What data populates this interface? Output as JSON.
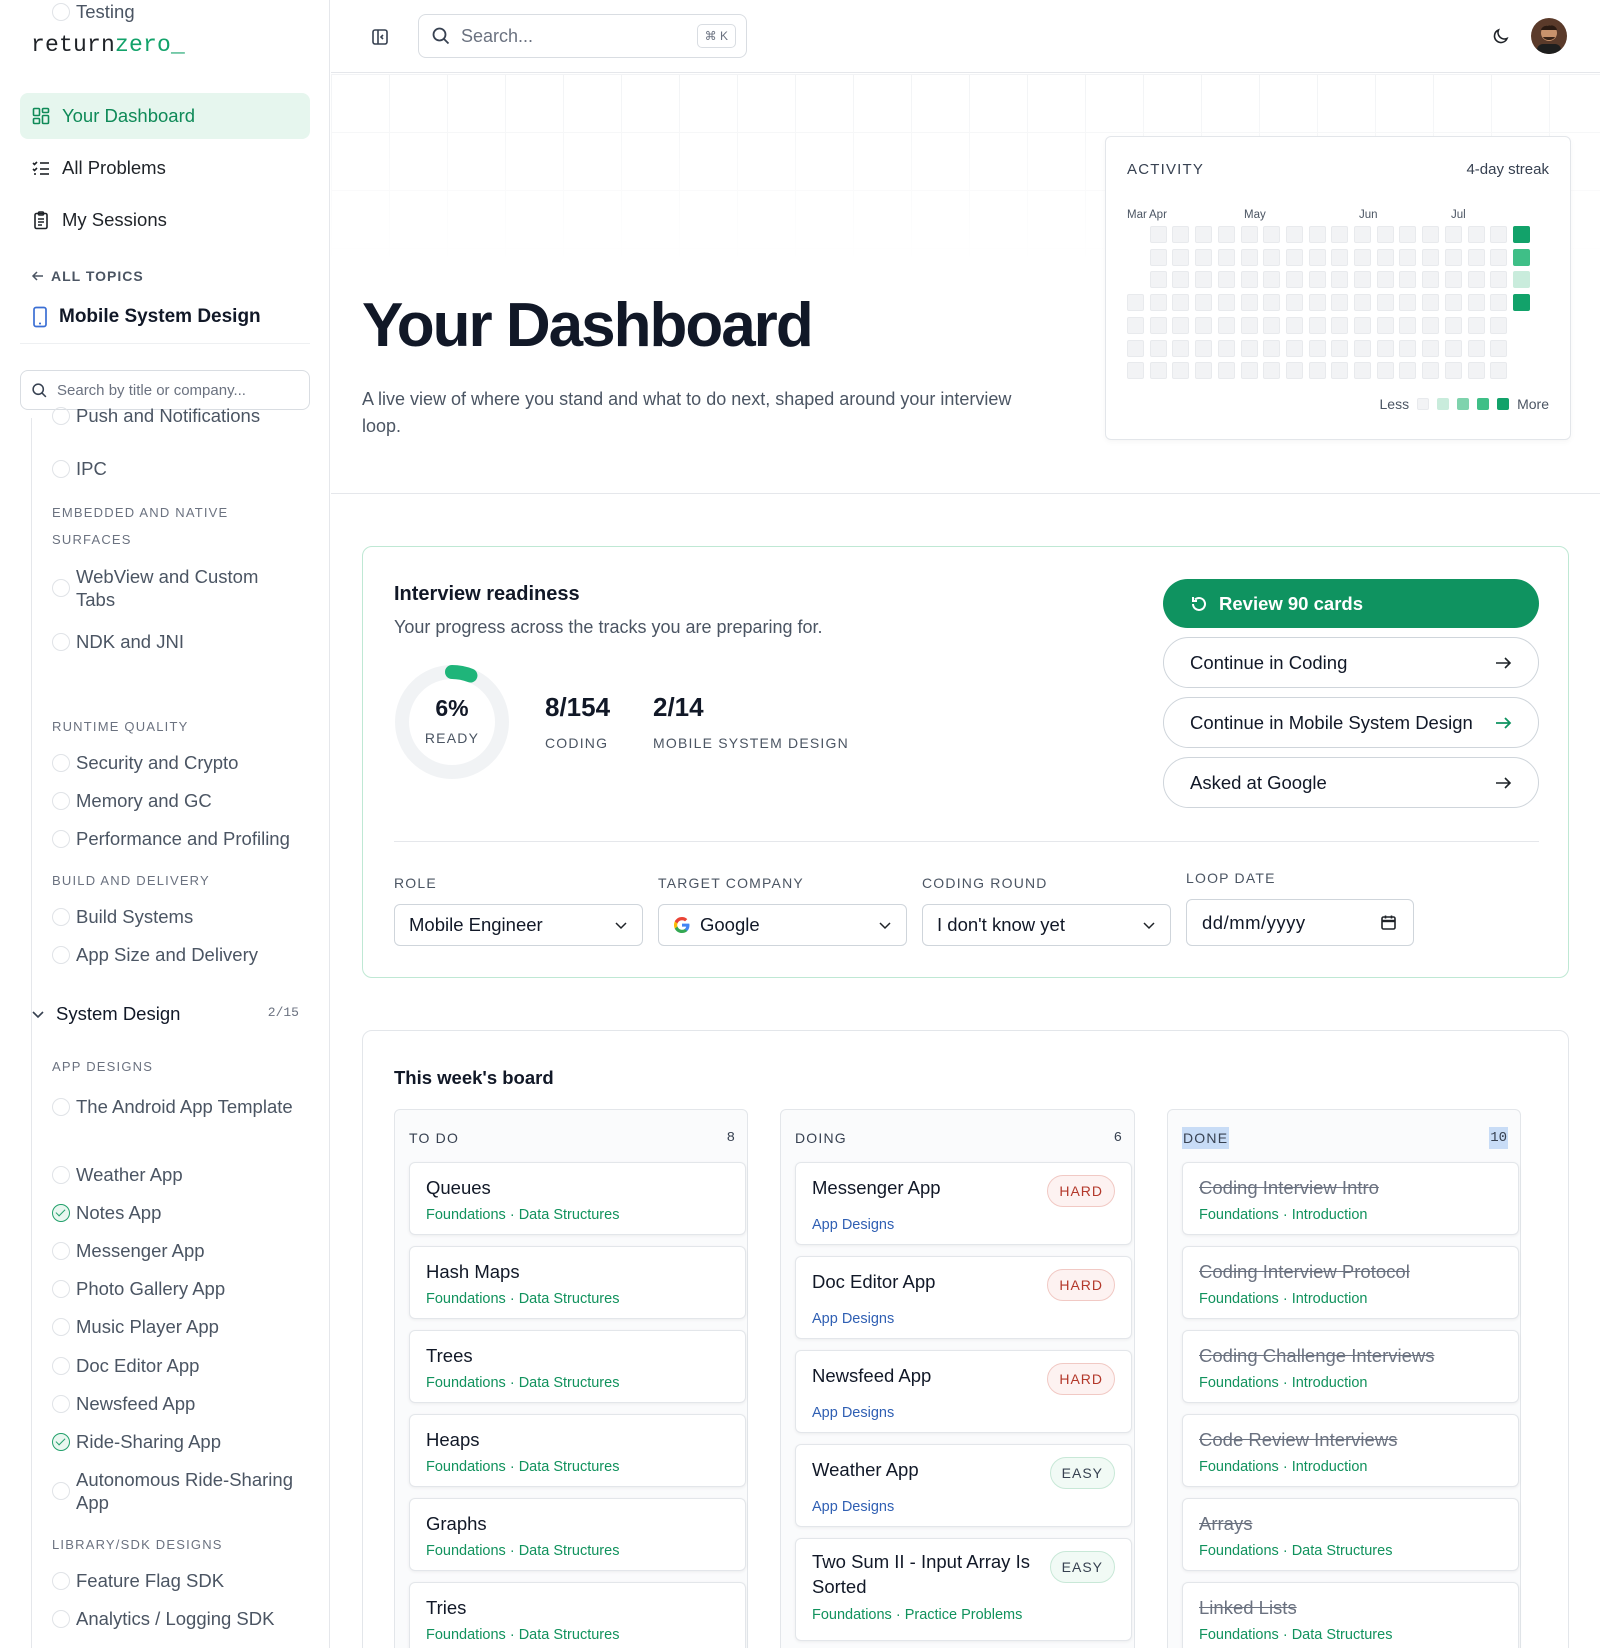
{
  "brand": {
    "logo_part1": "return",
    "logo_part2": "zero",
    "logo_part3": "_"
  },
  "sidebar": {
    "nav": [
      {
        "label": "Your Dashboard",
        "icon": "dashboard-icon",
        "active": true
      },
      {
        "label": "All Problems",
        "icon": "list-check-icon",
        "active": false
      },
      {
        "label": "My Sessions",
        "icon": "clipboard-icon",
        "active": false
      }
    ],
    "all_topics_label": "ALL TOPICS",
    "topic_title": "Mobile System Design",
    "search_placeholder": "Search by title or company...",
    "items": [
      {
        "kind": "item",
        "label": "Push and Notifications",
        "done": false
      },
      {
        "kind": "item",
        "label": "IPC",
        "done": false
      },
      {
        "kind": "head",
        "label": "EMBEDDED AND NATIVE SURFACES"
      },
      {
        "kind": "item",
        "label": "WebView and Custom Tabs",
        "done": false
      },
      {
        "kind": "item",
        "label": "NDK and JNI",
        "done": false
      },
      {
        "kind": "head",
        "label": "RUNTIME QUALITY"
      },
      {
        "kind": "item",
        "label": "Security and Crypto",
        "done": false
      },
      {
        "kind": "item",
        "label": "Memory and GC",
        "done": false
      },
      {
        "kind": "item",
        "label": "Performance and Profiling",
        "done": false
      },
      {
        "kind": "head",
        "label": "BUILD AND DELIVERY"
      },
      {
        "kind": "item",
        "label": "Build Systems",
        "done": false
      },
      {
        "kind": "item",
        "label": "App Size and Delivery",
        "done": false
      },
      {
        "kind": "item",
        "label": "Testing",
        "done": false
      }
    ],
    "system_design": {
      "label": "System Design",
      "count": "2/15"
    },
    "items2": [
      {
        "kind": "head",
        "label": "APP DESIGNS"
      },
      {
        "kind": "item",
        "label": "The Android App Template",
        "done": false
      },
      {
        "kind": "item",
        "label": "Weather App",
        "done": false
      },
      {
        "kind": "item",
        "label": "Notes App",
        "done": true
      },
      {
        "kind": "item",
        "label": "Messenger App",
        "done": false
      },
      {
        "kind": "item",
        "label": "Photo Gallery App",
        "done": false
      },
      {
        "kind": "item",
        "label": "Music Player App",
        "done": false
      },
      {
        "kind": "item",
        "label": "Doc Editor App",
        "done": false
      },
      {
        "kind": "item",
        "label": "Newsfeed App",
        "done": false
      },
      {
        "kind": "item",
        "label": "Ride-Sharing App",
        "done": true
      },
      {
        "kind": "item",
        "label": "Autonomous Ride-Sharing App",
        "done": false
      },
      {
        "kind": "head",
        "label": "LIBRARY/SDK DESIGNS"
      },
      {
        "kind": "item",
        "label": "Feature Flag SDK",
        "done": false
      },
      {
        "kind": "item",
        "label": "Analytics / Logging SDK",
        "done": false
      }
    ]
  },
  "topbar": {
    "search_placeholder": "Search...",
    "shortcut": "⌘ K",
    "theme_icon": "moon-icon",
    "avatar_icon": "avatar"
  },
  "hero": {
    "title": "Your Dashboard",
    "subtitle": "A live view of where you stand and what to do next, shaped around your interview loop."
  },
  "activity": {
    "title": "ACTIVITY",
    "streak": "4-day streak",
    "months": [
      "Mar",
      "Apr",
      "May",
      "Jun",
      "Jul"
    ],
    "legend_less": "Less",
    "legend_more": "More",
    "active_days": [
      {
        "week": 17,
        "day": 0,
        "level": 4
      },
      {
        "week": 17,
        "day": 1,
        "level": 3
      },
      {
        "week": 17,
        "day": 2,
        "level": 1
      },
      {
        "week": 17,
        "day": 3,
        "level": 4
      }
    ],
    "colors": [
      "#f2f3f5",
      "#c9ecdc",
      "#7fd3ad",
      "#3fbf87",
      "#12a26a"
    ]
  },
  "readiness": {
    "title": "Interview readiness",
    "subtitle": "Your progress across the tracks you are preparing for.",
    "ready_pct_text": "6%",
    "ready_fraction": 0.06,
    "ready_label": "READY",
    "stats": [
      {
        "value": "8/154",
        "label": "CODING"
      },
      {
        "value": "2/14",
        "label": "MOBILE SYSTEM DESIGN"
      }
    ],
    "primary_button": "Review 90 cards",
    "buttons": [
      "Continue in Coding",
      "Continue in Mobile System Design",
      "Asked at Google"
    ],
    "fields": {
      "role": {
        "label": "ROLE",
        "value": "Mobile Engineer"
      },
      "company": {
        "label": "TARGET COMPANY",
        "value": "Google"
      },
      "round": {
        "label": "CODING ROUND",
        "value": "I don't know yet"
      },
      "date": {
        "label": "LOOP DATE",
        "placeholder": "dd/mm/yyyy"
      }
    },
    "accent": "#0f9360"
  },
  "board": {
    "title": "This week's board",
    "columns": [
      {
        "name": "TO DO",
        "count": "8",
        "cards": [
          {
            "title": "Queues",
            "tag1": "Foundations",
            "tag2": "Data Structures"
          },
          {
            "title": "Hash Maps",
            "tag1": "Foundations",
            "tag2": "Data Structures"
          },
          {
            "title": "Trees",
            "tag1": "Foundations",
            "tag2": "Data Structures"
          },
          {
            "title": "Heaps",
            "tag1": "Foundations",
            "tag2": "Data Structures"
          },
          {
            "title": "Graphs",
            "tag1": "Foundations",
            "tag2": "Data Structures"
          },
          {
            "title": "Tries",
            "tag1": "Foundations",
            "tag2": "Data Structures"
          }
        ]
      },
      {
        "name": "DOING",
        "count": "6",
        "cards": [
          {
            "title": "Messenger App",
            "tag": "App Designs",
            "difficulty": "HARD"
          },
          {
            "title": "Doc Editor App",
            "tag": "App Designs",
            "difficulty": "HARD"
          },
          {
            "title": "Newsfeed App",
            "tag": "App Designs",
            "difficulty": "HARD"
          },
          {
            "title": "Weather App",
            "tag": "App Designs",
            "difficulty": "EASY"
          },
          {
            "title": "Two Sum II - Input Array Is Sorted",
            "tag1": "Foundations",
            "tag2": "Practice Problems",
            "difficulty": "EASY"
          }
        ]
      },
      {
        "name": "DONE",
        "count": "10",
        "cards": [
          {
            "title": "Coding Interview Intro",
            "tag1": "Foundations",
            "tag2": "Introduction"
          },
          {
            "title": "Coding Interview Protocol",
            "tag1": "Foundations",
            "tag2": "Introduction"
          },
          {
            "title": "Coding Challenge Interviews",
            "tag1": "Foundations",
            "tag2": "Introduction"
          },
          {
            "title": "Code Review Interviews",
            "tag1": "Foundations",
            "tag2": "Introduction"
          },
          {
            "title": "Arrays",
            "tag1": "Foundations",
            "tag2": "Data Structures"
          },
          {
            "title": "Linked Lists",
            "tag1": "Foundations",
            "tag2": "Data Structures"
          }
        ]
      }
    ]
  }
}
